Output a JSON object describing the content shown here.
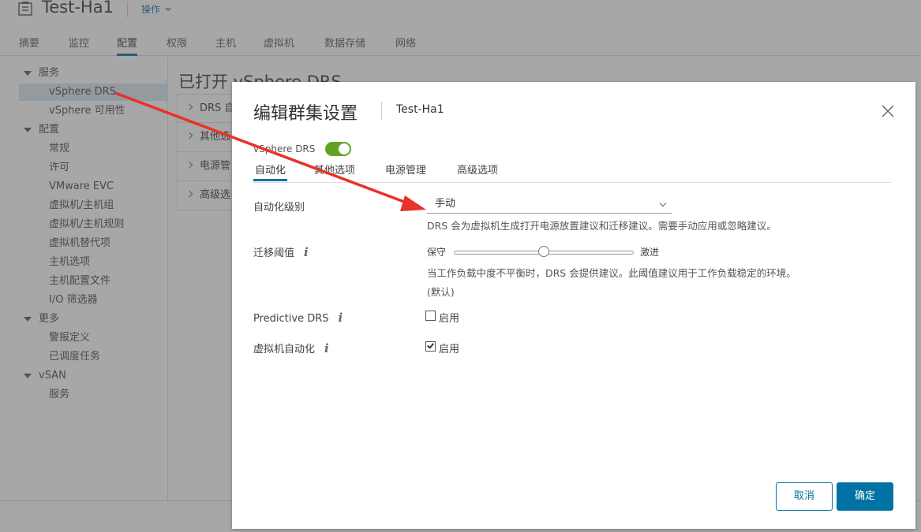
{
  "header": {
    "object_title": "Test-Ha1",
    "actions_label": "操作",
    "tabs": [
      {
        "label": "摘要"
      },
      {
        "label": "监控"
      },
      {
        "label": "配置"
      },
      {
        "label": "权限"
      },
      {
        "label": "主机"
      },
      {
        "label": "虚拟机"
      },
      {
        "label": "数据存储"
      },
      {
        "label": "网络"
      }
    ],
    "active_tab": "配置"
  },
  "sidebar": {
    "items": [
      {
        "label": "服务"
      },
      {
        "label": "vSphere DRS"
      },
      {
        "label": "vSphere 可用性"
      },
      {
        "label": "配置"
      },
      {
        "label": "常规"
      },
      {
        "label": "许可"
      },
      {
        "label": "VMware EVC"
      },
      {
        "label": "虚拟机/主机组"
      },
      {
        "label": "虚拟机/主机规则"
      },
      {
        "label": "虚拟机替代项"
      },
      {
        "label": "主机选项"
      },
      {
        "label": "主机配置文件"
      },
      {
        "label": "I/O 筛选器"
      },
      {
        "label": "更多"
      },
      {
        "label": "警报定义"
      },
      {
        "label": "已调度任务"
      },
      {
        "label": "vSAN"
      },
      {
        "label": "服务"
      }
    ],
    "selected": "vSphere DRS"
  },
  "main": {
    "title": "已打开 vSphere DRS",
    "sections": [
      {
        "label": "DRS 自"
      },
      {
        "label": "其他选"
      },
      {
        "label": "电源管"
      },
      {
        "label": "高级选"
      }
    ]
  },
  "modal": {
    "title": "编辑群集设置",
    "subtitle": "Test-Ha1",
    "drs_toggle_label": "vSphere DRS",
    "drs_enabled": true,
    "tabs": [
      {
        "label": "自动化"
      },
      {
        "label": "其他选项"
      },
      {
        "label": "电源管理"
      },
      {
        "label": "高级选项"
      }
    ],
    "active_tab": "自动化",
    "automation_level": {
      "label": "自动化级别",
      "value": "手动",
      "help": "DRS 会为虚拟机生成打开电源放置建议和迁移建议。需要手动应用或忽略建议。"
    },
    "migration_threshold": {
      "label": "迁移阈值",
      "min_label": "保守",
      "max_label": "激进",
      "level": 3,
      "levels": 5,
      "help_line1": "当工作负载中度不平衡时，DRS 会提供建议。此阈值建议用于工作负载稳定的环境。",
      "help_line2": "(默认)"
    },
    "predictive_drs": {
      "label": "Predictive DRS",
      "checkbox_label": "启用",
      "checked": false
    },
    "vm_automation": {
      "label": "虚拟机自动化",
      "checkbox_label": "启用",
      "checked": true
    },
    "cancel_label": "取消",
    "ok_label": "确定"
  },
  "colors": {
    "accent": "#0072a3",
    "toggle_on": "#62a420",
    "annotation_arrow": "#e8322b"
  }
}
